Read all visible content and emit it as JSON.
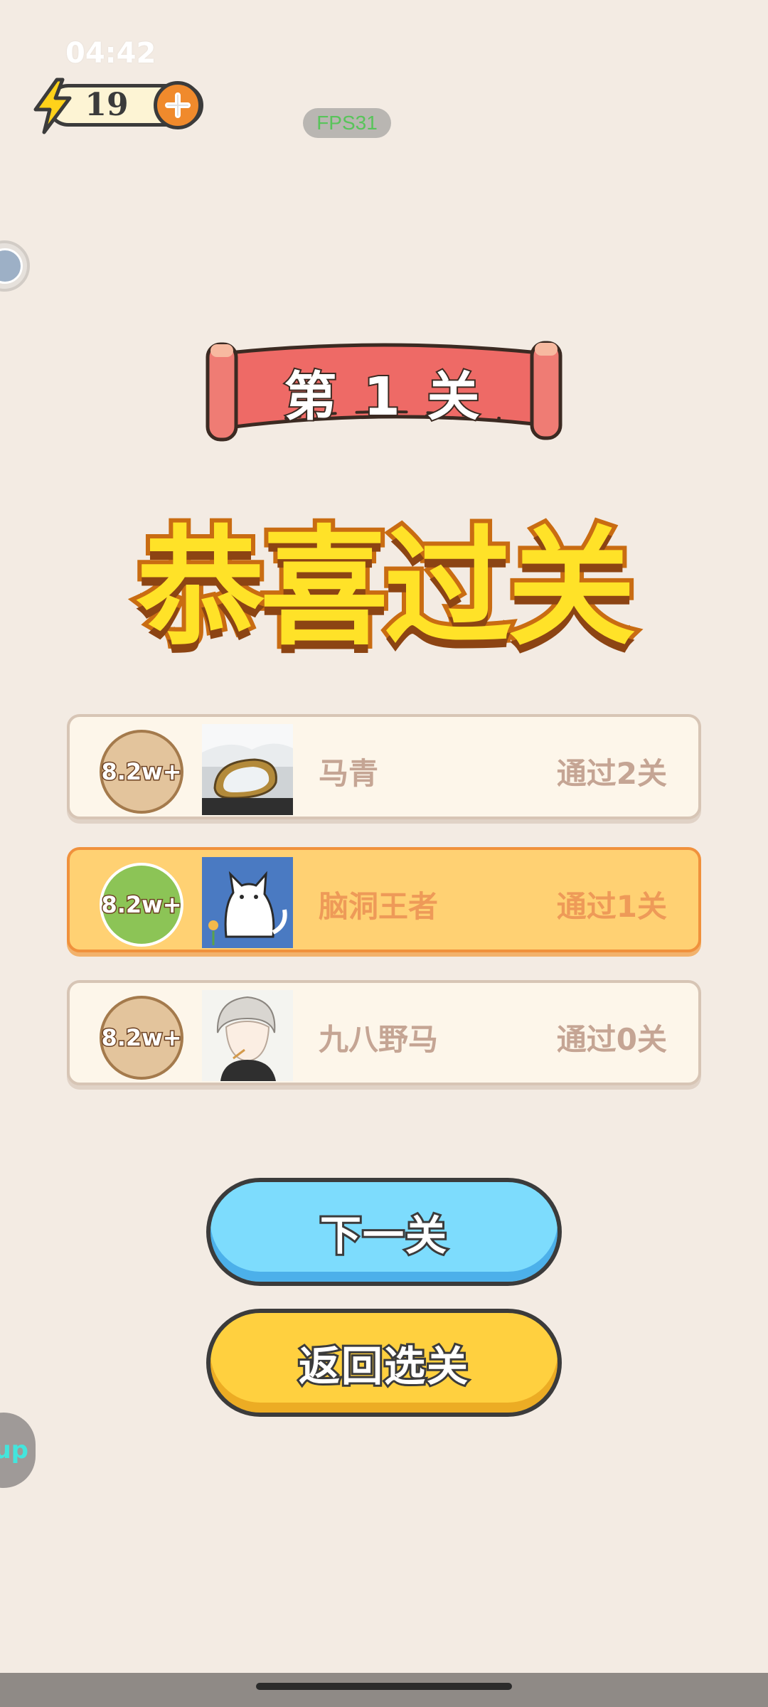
{
  "status_bar": {
    "time": "04:42"
  },
  "energy": {
    "count": "19",
    "bolt_icon": "lightning-bolt-icon",
    "add_icon": "plus-icon",
    "colors": {
      "bolt": "#ffd21a",
      "plus_bg": "#f08a2c"
    }
  },
  "debug": {
    "fps": "FPS31"
  },
  "banner": {
    "level": "第 1 关"
  },
  "title": "恭喜过关",
  "leaderboard": [
    {
      "badge": "8.2w+",
      "name": "马青",
      "stat": "通过2关",
      "avatar": "car-mirror-snow-avatar",
      "highlight": false
    },
    {
      "badge": "8.2w+",
      "name": "脑洞王者",
      "stat": "通过1关",
      "avatar": "white-cat-avatar",
      "highlight": true
    },
    {
      "badge": "8.2w+",
      "name": "九八野马",
      "stat": "通过0关",
      "avatar": "anime-boy-avatar",
      "highlight": false
    }
  ],
  "buttons": {
    "next": "下一关",
    "back": "返回选关"
  },
  "side_bubble": {
    "label": "up"
  },
  "colors": {
    "background": "#f3ebe3",
    "next_button": "#7ddcfd",
    "back_button": "#ffd03f",
    "highlight_row": "#ffd173",
    "title_fill": "#ffe228",
    "banner_ribbon": "#ee6a66"
  }
}
